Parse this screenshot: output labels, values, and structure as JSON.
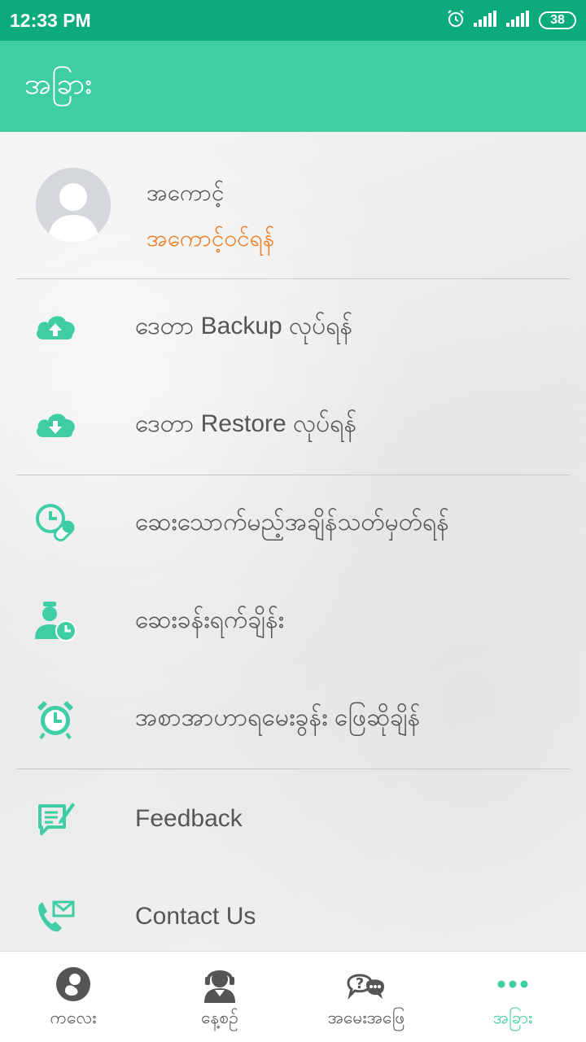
{
  "status_bar": {
    "time": "12:33 PM",
    "battery": "38"
  },
  "app_bar": {
    "title": "အခြား"
  },
  "profile": {
    "name": "အကောင့်",
    "login_label": "အကောင့်ဝင်ရန်"
  },
  "menu": {
    "backup": "ဒေတာ Backup လုပ်ရန်",
    "restore": "ဒေတာ Restore လုပ်ရန်",
    "medicine_reminder": "ဆေးသောက်မည့်အချိန်သတ်မှတ်ရန်",
    "appointment": "ဆေးခန်းရက်ချိန်း",
    "food_question": "အစာအာဟာရမေးခွန်း ဖြေဆိုချိန်",
    "feedback": "Feedback",
    "contact": "Contact Us"
  },
  "bottom_nav": [
    {
      "label": "ကလေး",
      "icon": "baby-icon"
    },
    {
      "label": "နေ့စဉ်",
      "icon": "headset-person-icon"
    },
    {
      "label": "အမေးအဖြေ",
      "icon": "qa-chat-icon"
    },
    {
      "label": "အခြား",
      "icon": "more-dots-icon",
      "active": true
    }
  ],
  "colors": {
    "status_bar": "#0bab7d",
    "app_bar": "#3fcea4",
    "accent": "#3fcea4",
    "login_text": "#ee7a1c"
  }
}
